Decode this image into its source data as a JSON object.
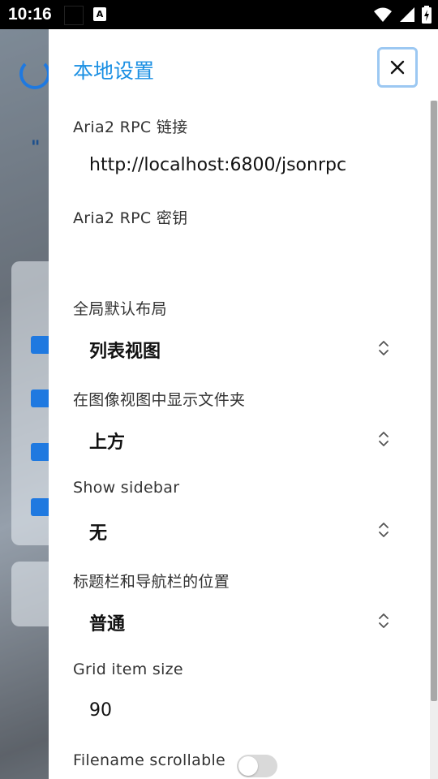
{
  "status_bar": {
    "time": "10:16",
    "notification_badge": "A"
  },
  "drawer": {
    "title": "本地设置",
    "settings": {
      "rpc_link_label": "Aria2 RPC 链接",
      "rpc_link_value": "http://localhost:6800/jsonrpc",
      "rpc_secret_label": "Aria2 RPC 密钥",
      "rpc_secret_value": "",
      "layout_label": "全局默认布局",
      "layout_value": "列表视图",
      "folders_label": "在图像视图中显示文件夹",
      "folders_value": "上方",
      "sidebar_label": "Show sidebar",
      "sidebar_value": "无",
      "navbar_label": "标题栏和导航栏的位置",
      "navbar_value": "普通",
      "grid_label": "Grid item size",
      "grid_value": "90",
      "scrollable_label": "Filename scrollable",
      "scrollable_on": false
    }
  },
  "icons": {
    "close": "close-icon",
    "select": "chevron-updown-icon",
    "wifi": "wifi-icon",
    "signal": "signal-icon",
    "battery": "battery-charging-icon"
  },
  "colors": {
    "accent": "#1a8fe3",
    "close_border": "#9cc8f2"
  }
}
